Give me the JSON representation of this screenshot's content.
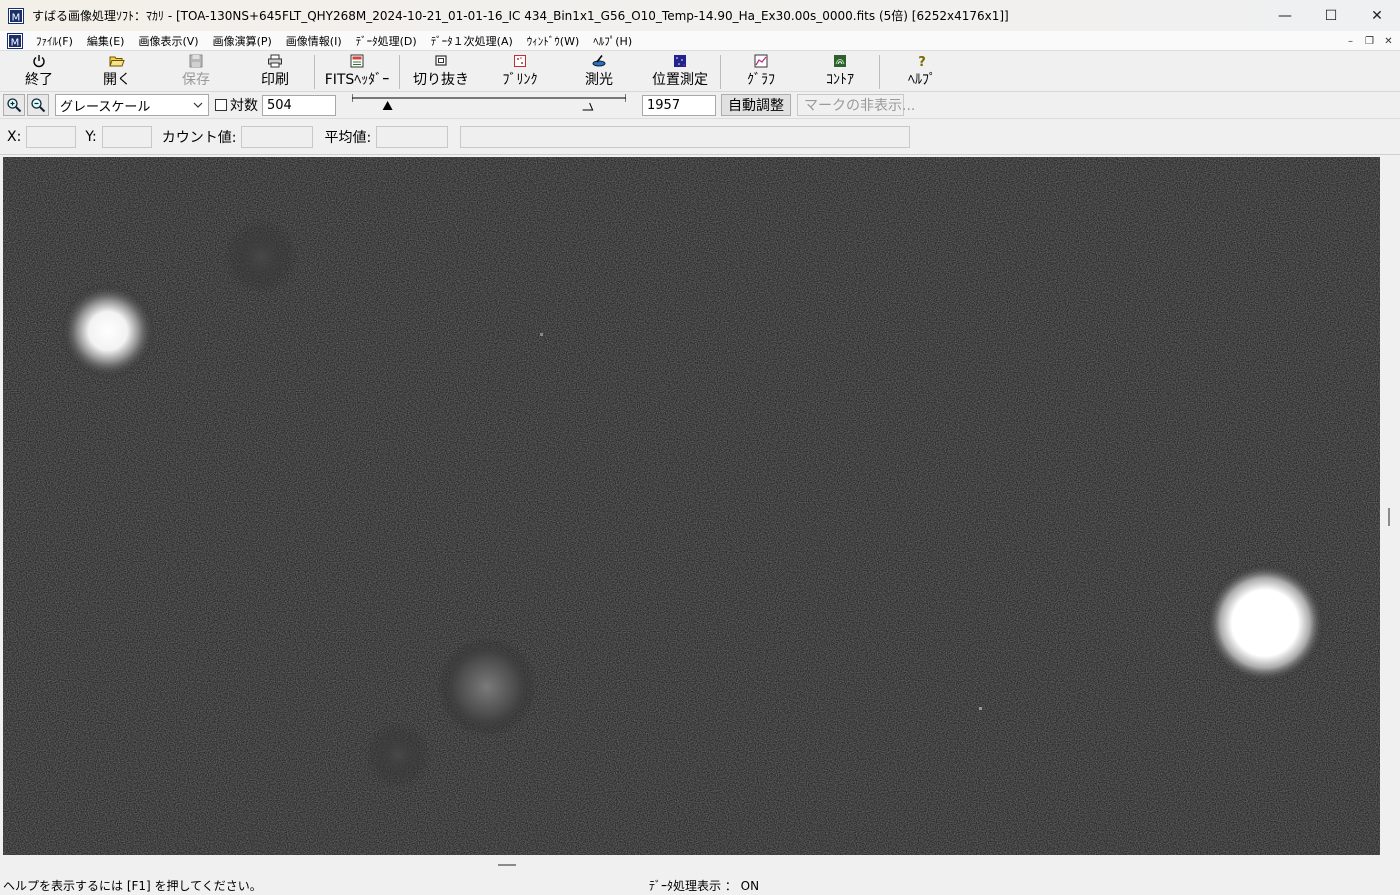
{
  "window": {
    "title": "すばる画像処理ｿﾌﾄ：ﾏｶﾘ - [TOA-130NS+645FLT_QHY268M_2024-10-21_01-01-16_IC 434_Bin1x1_G56_O10_Temp-14.90_Ha_Ex30.00s_0000.fits (5倍) [6252x4176x1]]",
    "minimize": "—",
    "maximize": "☐",
    "close": "✕"
  },
  "menu": {
    "items": [
      {
        "label": "ﾌｧｲﾙ(F)"
      },
      {
        "label": "編集(E)"
      },
      {
        "label": "画像表示(V)"
      },
      {
        "label": "画像演算(P)"
      },
      {
        "label": "画像情報(I)"
      },
      {
        "label": "ﾃﾞｰﾀ処理(D)"
      },
      {
        "label": "ﾃﾞｰﾀ１次処理(A)"
      },
      {
        "label": "ｳｨﾝﾄﾞｳ(W)"
      },
      {
        "label": "ﾍﾙﾌﾟ(H)"
      }
    ],
    "mdi_minimize": "–",
    "mdi_restore": "❐",
    "mdi_close": "✕"
  },
  "toolbar": {
    "exit": "終了",
    "open": "開く",
    "save": "保存",
    "print": "印刷",
    "fits_header": "FITSﾍｯﾀﾞｰ",
    "crop": "切り抜き",
    "blink": "ﾌﾞﾘﾝｸ",
    "photometry": "測光",
    "astrometry": "位置測定",
    "graph": "ｸﾞﾗﾌ",
    "contour": "ｺﾝﾄｱ",
    "help": "ﾍﾙﾌﾟ"
  },
  "display": {
    "color_mode": "グレースケール",
    "log_label": "対数",
    "log_checked": false,
    "min_value": "504",
    "max_value": "1957",
    "min_slider_fraction": 0.13,
    "max_slider_fraction": 0.86,
    "auto_adjust": "自動調整",
    "hide_marks": "マークの非表示..."
  },
  "coords": {
    "x_label": "X:",
    "y_label": "Y:",
    "count_label": "カウント値:",
    "mean_label": "平均値:",
    "x": "",
    "y": "",
    "count": "",
    "mean": "",
    "info": ""
  },
  "status": {
    "help_hint": "ヘルプを表示するには [F1] を押してください。",
    "data_mode": "ﾃﾞｰﾀ処理表示 ： ON"
  }
}
